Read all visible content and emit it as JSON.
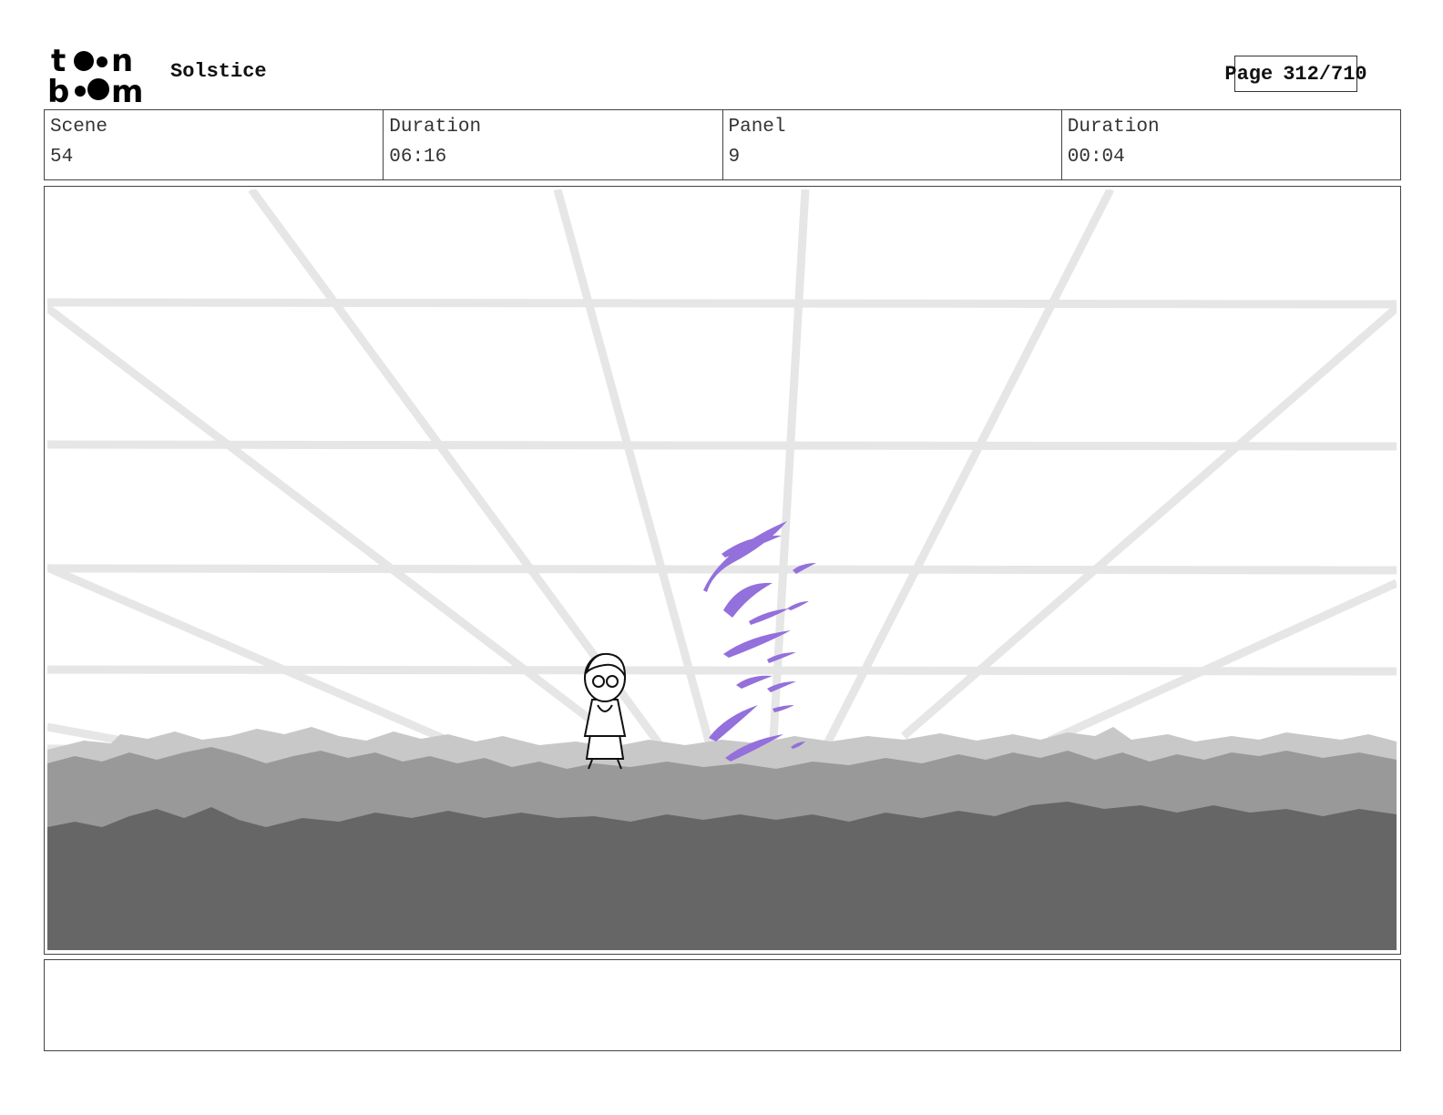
{
  "header": {
    "logo_text": [
      "t",
      "n",
      "b",
      "m"
    ],
    "project_title": "Solstice",
    "page_label": "Page",
    "page_value": "312/710"
  },
  "info": {
    "scene_label": "Scene",
    "scene_value": "54",
    "scene_duration_label": "Duration",
    "scene_duration_value": "06:16",
    "panel_label": "Panel",
    "panel_value": "9",
    "panel_duration_label": "Duration",
    "panel_duration_value": "00:04"
  },
  "colors": {
    "grid": "#e6e6e6",
    "fog_light": "#c8c8c8",
    "fog_mid": "#999999",
    "fog_dark": "#666666",
    "effect_purple": "#9370db"
  },
  "notes": {
    "text": ""
  }
}
